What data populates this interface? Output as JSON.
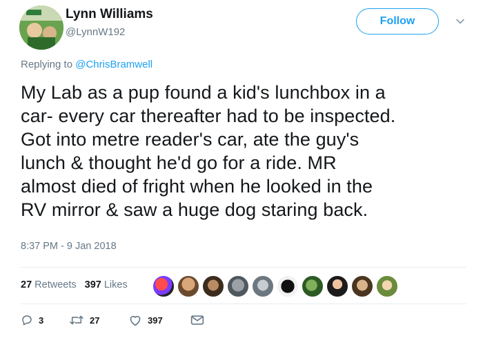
{
  "author": {
    "name": "Lynn Williams",
    "handle": "@LynnW192",
    "follow_label": "Follow"
  },
  "reply": {
    "prefix": "Replying to",
    "mention": "@ChrisBramwell"
  },
  "tweet": {
    "text": "My Lab as a pup found a kid's lunchbox in a\ncar- every car thereafter had to be inspected.\nGot into metre reader's car, ate the guy's\nlunch & thought he'd go for a ride. MR\nalmost died of fright when he looked in the\nRV mirror & saw a huge dog staring back.",
    "timestamp": "8:37 PM - 9 Jan 2018"
  },
  "stats": {
    "retweets_count": "27",
    "retweets_label": "Retweets",
    "likes_count": "397",
    "likes_label": "Likes"
  },
  "actions": {
    "replies": "3",
    "retweets": "27",
    "likes": "397"
  },
  "colors": {
    "accent": "#1da1f2",
    "secondary_text": "#657786",
    "divider": "#e6ecf0"
  },
  "liker_avatars": [
    "avatar-1",
    "avatar-2",
    "avatar-3",
    "avatar-4",
    "avatar-5",
    "avatar-6",
    "avatar-7",
    "avatar-8",
    "avatar-9",
    "avatar-10"
  ]
}
